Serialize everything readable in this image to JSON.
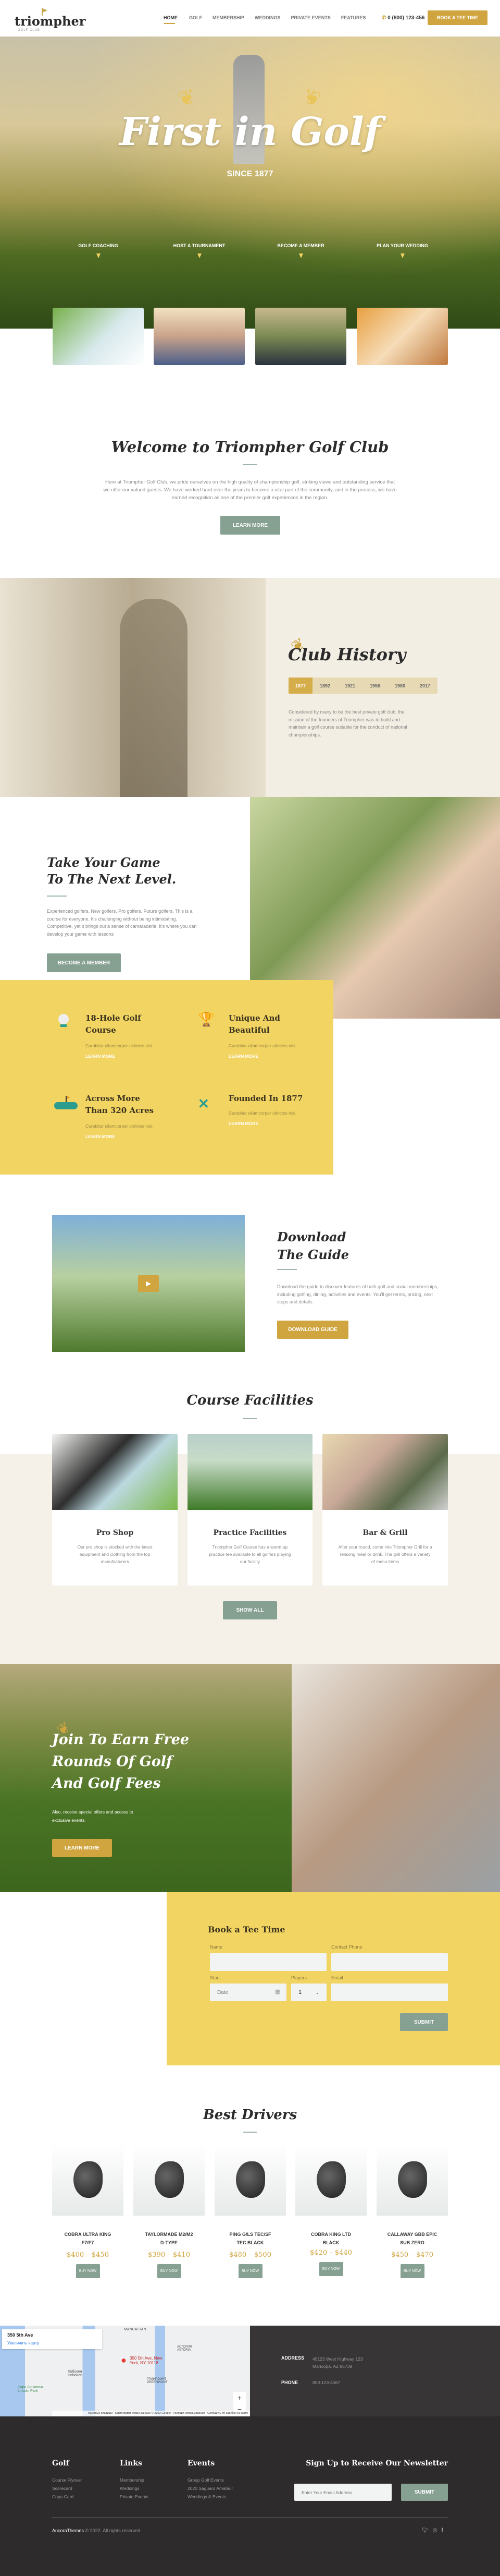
{
  "colors": {
    "gold": "#d0a540",
    "sage": "#86a092",
    "yellow": "#f2d462",
    "beige": "#f5f1e8",
    "dark": "#2d2b2c"
  },
  "header": {
    "logo": "triompher",
    "logo_sub": "GOLF CLUB",
    "nav": [
      "HOME",
      "GOLF",
      "MEMBERSHIP",
      "WEDDINGS",
      "PRIVATE EVENTS",
      "FEATURES"
    ],
    "active": "HOME",
    "phone": "0 (800) 123-456",
    "cta": "BOOK A TEE TIME"
  },
  "hero": {
    "title": "First in Golf",
    "subtitle": "SINCE 1877",
    "services": [
      "GOLF COACHING",
      "HOST A TOURNAMENT",
      "BECOME A MEMBER",
      "PLAN YOUR WEDDING"
    ]
  },
  "welcome": {
    "title": "Welcome to Triompher Golf Club",
    "text": "Here at Triompher Golf Club, we pride ourselves on the high quality of championship golf, striking views and outstanding service that we offer our valued guests. We have worked hard over the years to become a vital part of the community, and in the process, we have earned recognition as one of the premier golf experiences in the region.",
    "button": "LEARN MORE"
  },
  "history": {
    "title": "Club History",
    "years": [
      "1877",
      "1892",
      "1921",
      "1956",
      "1980",
      "2017"
    ],
    "active_year": "1877",
    "text": "Considered by many to be the best private golf club, the mission of the founders of Triompher was to build and maintain a golf course suitable for the conduct of national championships."
  },
  "next_level": {
    "title_line1": "Take Your Game",
    "title_line2": "To The Next Level.",
    "text": "Experienced golfers. New golfers. Pro golfers. Future golfers. This is a course for everyone. It's challenging without being intimidating. Competitive, yet it brings out a sense of camaraderie. It's where you can develop your game with lessons",
    "button": "BECOME A MEMBER"
  },
  "features": [
    {
      "icon": "golf-ball-tee-icon",
      "title": "18-Hole Golf Course",
      "text": "Curabitur ullamcorper ultricies nisi.",
      "link": "LEARN MORE"
    },
    {
      "icon": "trophy-icon",
      "title": "Unique And Beautiful",
      "text": "Curabitur ullamcorper ultricies nisi.",
      "link": "LEARN MORE"
    },
    {
      "icon": "golf-green-icon",
      "title": "Across More Than 320 Acres",
      "text": "Curabitur ullamcorper ultricies nisi.",
      "link": "LEARN MORE"
    },
    {
      "icon": "crossed-flags-icon",
      "title": "Founded In 1877",
      "text": "Curabitur ullamcorper ultricies nisi.",
      "link": "LEARN MORE"
    }
  ],
  "guide": {
    "title_line1": "Download",
    "title_line2": "The Guide",
    "text": "Download the guide to discover features of both golf and social memberships, including golfing, dining, activities and events. You'll get terms, pricing, next steps and details.",
    "button": "DOWNLOAD GUIDE"
  },
  "facilities": {
    "title": "Course Facilities",
    "items": [
      {
        "title": "Pro Shop",
        "text": "Our pro shop is stocked with the latest equipment and clothing from the top manufacturers"
      },
      {
        "title": "Practice Facilities",
        "text": "Triompher Golf Course has a warm-up practice tee available to all golfers playing our facility"
      },
      {
        "title": "Bar & Grill",
        "text": "After your round, come into Triompher Grill for a relaxing meal or drink. The grill offers a variety of menu items"
      }
    ],
    "button": "SHOW ALL"
  },
  "join": {
    "title": "Join To Earn Free Rounds Of Golf And Golf Fees",
    "text": "Also, receive special offers and access to exclusive events.",
    "button": "LEARN MORE"
  },
  "booking": {
    "title": "Book a Tee Time",
    "name_label": "Name",
    "phone_label": "Contact Phone",
    "start_label": "Start",
    "date_placeholder": "Date",
    "players_label": "Players",
    "players_value": "1",
    "email_label": "Email",
    "submit": "SUBMIT"
  },
  "drivers": {
    "title": "Best Drivers",
    "items": [
      {
        "name": "COBRA ULTRA KING F7/F7",
        "price": "$400 – $450",
        "button": "BUY NOW"
      },
      {
        "name": "TAYLORMADE M2/M2 D-TYPE",
        "price": "$390 – $410",
        "button": "BUY NOW"
      },
      {
        "name": "PING G/LS TEC/SF TEC BLACK",
        "price": "$480 – $500",
        "button": "BUY NOW"
      },
      {
        "name": "COBRA KING LTD BLACK",
        "price": "$420 – $440",
        "button": "BUY NOW"
      },
      {
        "name": "CALLAWAY GBB EPIC SUB ZERO",
        "price": "$450 – $470",
        "button": "BUY NOW"
      }
    ]
  },
  "map": {
    "place": "350 5th Ave",
    "enlarge": "Увеличить карту",
    "pin_label": "350 5th Ave, New York, NY 10118",
    "labels": [
      "MANHATTAN",
      "Хобокен Hoboken",
      "АСТОРИЯ ASTORIA",
      "ГРИНПОЙНТ GREENPOINT",
      "Парк Линкольн Lincoln Park"
    ],
    "attribution": "Быстрые клавиши   Картографические данные © 2022 Google   Условия использования   Сообщить об ошибке на карте"
  },
  "contact": {
    "address_label": "ADDRESS",
    "address_line1": "45123 West Highway 123",
    "address_line2": "Maricopa, AZ 85739",
    "phone_label": "PHONE",
    "phone": "800-123-4567"
  },
  "footer": {
    "columns": [
      {
        "title": "Golf",
        "links": [
          "Course Flyover",
          "Scorecard",
          "Copa Card"
        ]
      },
      {
        "title": "Links",
        "links": [
          "Membership",
          "Weddings",
          "Private Events"
        ]
      },
      {
        "title": "Events",
        "links": [
          "Group Golf Events",
          "2020 Saguaro Amateur",
          "Weddings & Events"
        ]
      }
    ],
    "newsletter_title": "Sign Up to Receive Our Newsletter",
    "email_placeholder": "Enter Your Email Address",
    "submit": "SUBMIT",
    "brand": "AncoraThemes",
    "copyright": "© 2022. All rights reserved.",
    "social": [
      "twitter-icon",
      "instagram-icon",
      "facebook-icon"
    ]
  }
}
